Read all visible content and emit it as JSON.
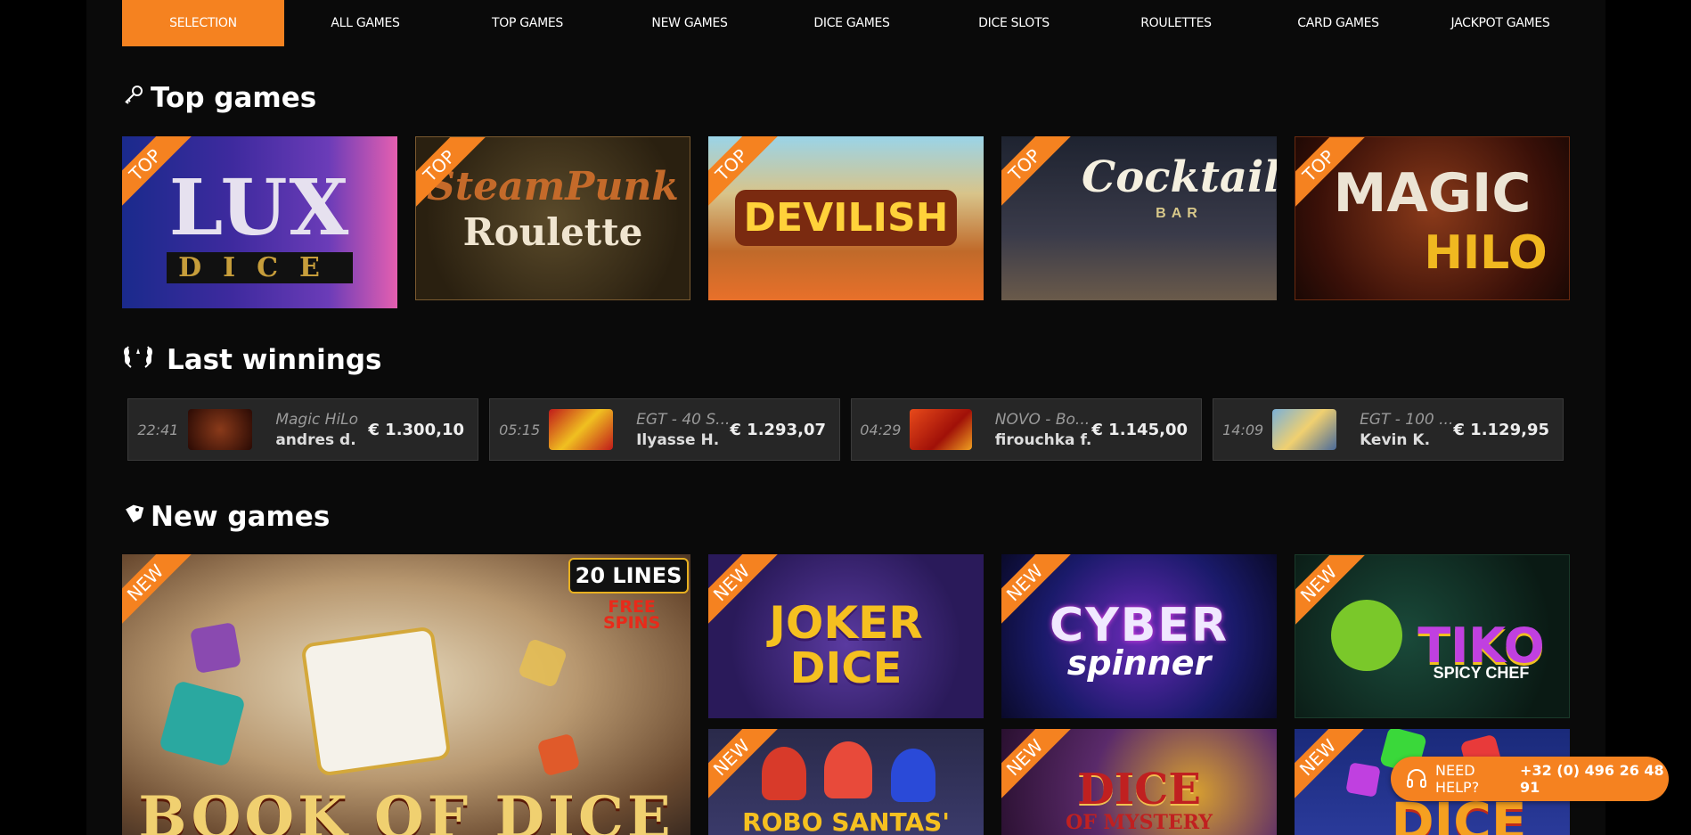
{
  "nav": {
    "items": [
      {
        "label": "SELECTION",
        "active": true
      },
      {
        "label": "ALL GAMES"
      },
      {
        "label": "TOP GAMES"
      },
      {
        "label": "NEW GAMES"
      },
      {
        "label": "DICE GAMES"
      },
      {
        "label": "DICE SLOTS"
      },
      {
        "label": "ROULETTES"
      },
      {
        "label": "CARD GAMES"
      },
      {
        "label": "JACKPOT GAMES"
      }
    ]
  },
  "top_games": {
    "title": "Top games",
    "ribbon": "TOP",
    "games": [
      {
        "name": "LUX",
        "sub": "DICE"
      },
      {
        "name": "SteamPunk",
        "sub": "Roulette"
      },
      {
        "name": "DEVILISH"
      },
      {
        "name": "Cocktail",
        "sub": "BAR"
      },
      {
        "name": "MAGIC",
        "sub": "HILO"
      }
    ]
  },
  "last_winnings": {
    "title": "Last winnings",
    "items": [
      {
        "time": "22:41",
        "game": "Magic HiLo",
        "user": "andres d.",
        "amount": "€ 1.300,10"
      },
      {
        "time": "05:15",
        "game": "EGT - 40 S...",
        "user": "Ilyasse H.",
        "amount": "€ 1.293,07"
      },
      {
        "time": "04:29",
        "game": "NOVO - Bo...",
        "user": "firouchka f.",
        "amount": "€ 1.145,00"
      },
      {
        "time": "14:09",
        "game": "EGT - 100 ...",
        "user": "Kevin K.",
        "amount": "€ 1.129,95"
      }
    ]
  },
  "new_games": {
    "title": "New games",
    "ribbon": "NEW",
    "featured": {
      "name": "BOOK OF DICE",
      "badge_lines": "20 LINES",
      "badge_spins_a": "FREE",
      "badge_spins_b": "SPINS"
    },
    "games": [
      {
        "name": "JOKER",
        "sub": "DICE"
      },
      {
        "name": "CYBER",
        "sub": "spinner"
      },
      {
        "name": "TIKO",
        "sub": "SPICY CHEF"
      },
      {
        "name": "ROBO SANTAS'"
      },
      {
        "name": "DICE",
        "sub": "OF MYSTERY"
      },
      {
        "name": "DICE"
      }
    ]
  },
  "help": {
    "label": "NEED HELP?",
    "phone": "+32 (0) 496 26 48 91"
  },
  "colors": {
    "accent": "#f58220",
    "background": "#0a0a0a",
    "card": "#262626"
  }
}
